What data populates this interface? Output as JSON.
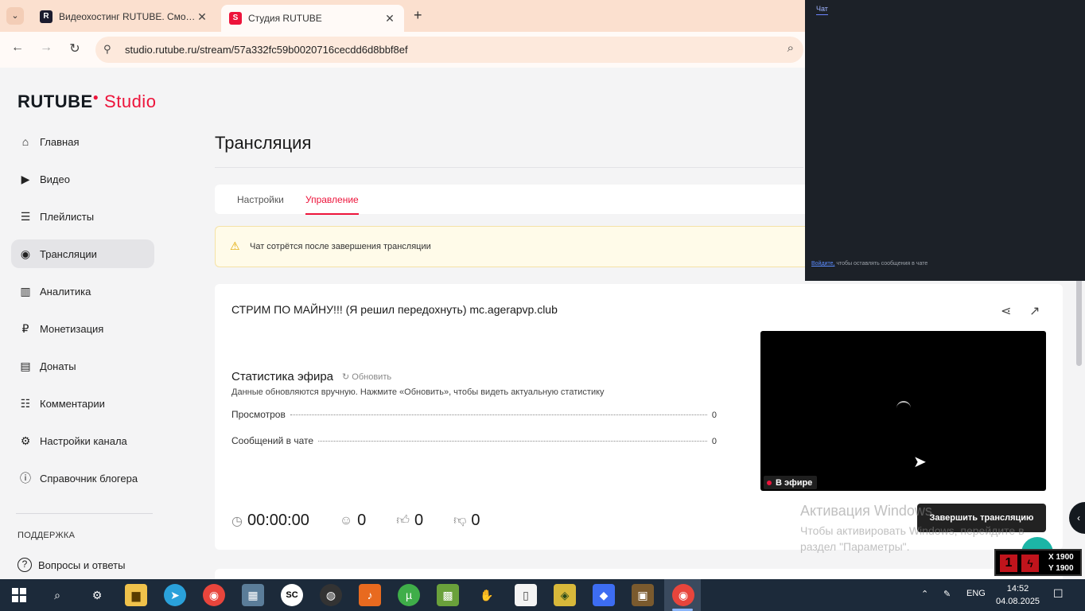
{
  "browser": {
    "tabs": [
      {
        "title": "Видеохостинг RUTUBE. Смотр...",
        "favicon": "rutube-icon",
        "active": false
      },
      {
        "title": "Студия RUTUBE",
        "favicon": "rutube-studio-icon",
        "active": true
      }
    ],
    "new_tab": "+",
    "url": "studio.rutube.ru/stream/57a332fc59b0020716cecdd6d8bbf8ef"
  },
  "logo": {
    "brand": "RUTUBE",
    "product": "Studio"
  },
  "sidebar": {
    "items": [
      {
        "label": "Главная",
        "icon": "home-icon",
        "glyph": "⌂"
      },
      {
        "label": "Видео",
        "icon": "video-icon",
        "glyph": "▶"
      },
      {
        "label": "Плейлисты",
        "icon": "playlist-icon",
        "glyph": "☰"
      },
      {
        "label": "Трансляции",
        "icon": "broadcast-icon",
        "glyph": "◉"
      },
      {
        "label": "Аналитика",
        "icon": "analytics-icon",
        "glyph": "▥"
      },
      {
        "label": "Монетизация",
        "icon": "ruble-icon",
        "glyph": "₽"
      },
      {
        "label": "Донаты",
        "icon": "wallet-icon",
        "glyph": "▤"
      },
      {
        "label": "Комментарии",
        "icon": "comments-icon",
        "glyph": "☷"
      },
      {
        "label": "Настройки канала",
        "icon": "gear-icon",
        "glyph": "⚙"
      },
      {
        "label": "Справочник блогера",
        "icon": "info-icon",
        "glyph": "ⓘ"
      }
    ],
    "support_heading": "ПОДДЕРЖКА",
    "faq": {
      "label": "Вопросы и ответы",
      "icon": "question-icon",
      "glyph": "?"
    }
  },
  "main": {
    "title": "Трансляция",
    "tabs": [
      {
        "label": "Настройки"
      },
      {
        "label": "Управление"
      }
    ],
    "warning": "Чат сотрётся после завершения трансляции",
    "stream": {
      "title": "СТРИМ ПО МАЙНУ!!! (Я решил передохнуть) mc.agerapvp.club",
      "stats_heading": "Статистика эфира",
      "refresh_label": "Обновить",
      "stats_note": "Данные обновляются вручную. Нажмите «Обновить», чтобы видеть актуальную статистику",
      "views_label": "Просмотров",
      "views_value": "0",
      "chat_label": "Сообщений в чате",
      "chat_value": "0",
      "timer": "00:00:00",
      "viewers": "0",
      "likes": "0",
      "dislikes": "0",
      "live_badge": "В эфире",
      "end_button": "Завершить трансляцию"
    }
  },
  "windows_activation": {
    "title": "Активация Windows",
    "text": "Чтобы активировать Windows, перейдите в раздел \"Параметры\"."
  },
  "chat_panel": {
    "tab": "Чат",
    "login_link": "Войдите,",
    "login_text": "чтобы оставлять сообщения в чате"
  },
  "overlay": {
    "badge1": "1",
    "x_label": "X 1900",
    "y_label": "Y 1900"
  },
  "taskbar": {
    "lang": "ENG",
    "time": "14:52",
    "date": "04.08.2025"
  },
  "colors": {
    "accent": "#ed143b",
    "taskbar": "#1c2a3a",
    "chat_bg": "#1c2128"
  }
}
